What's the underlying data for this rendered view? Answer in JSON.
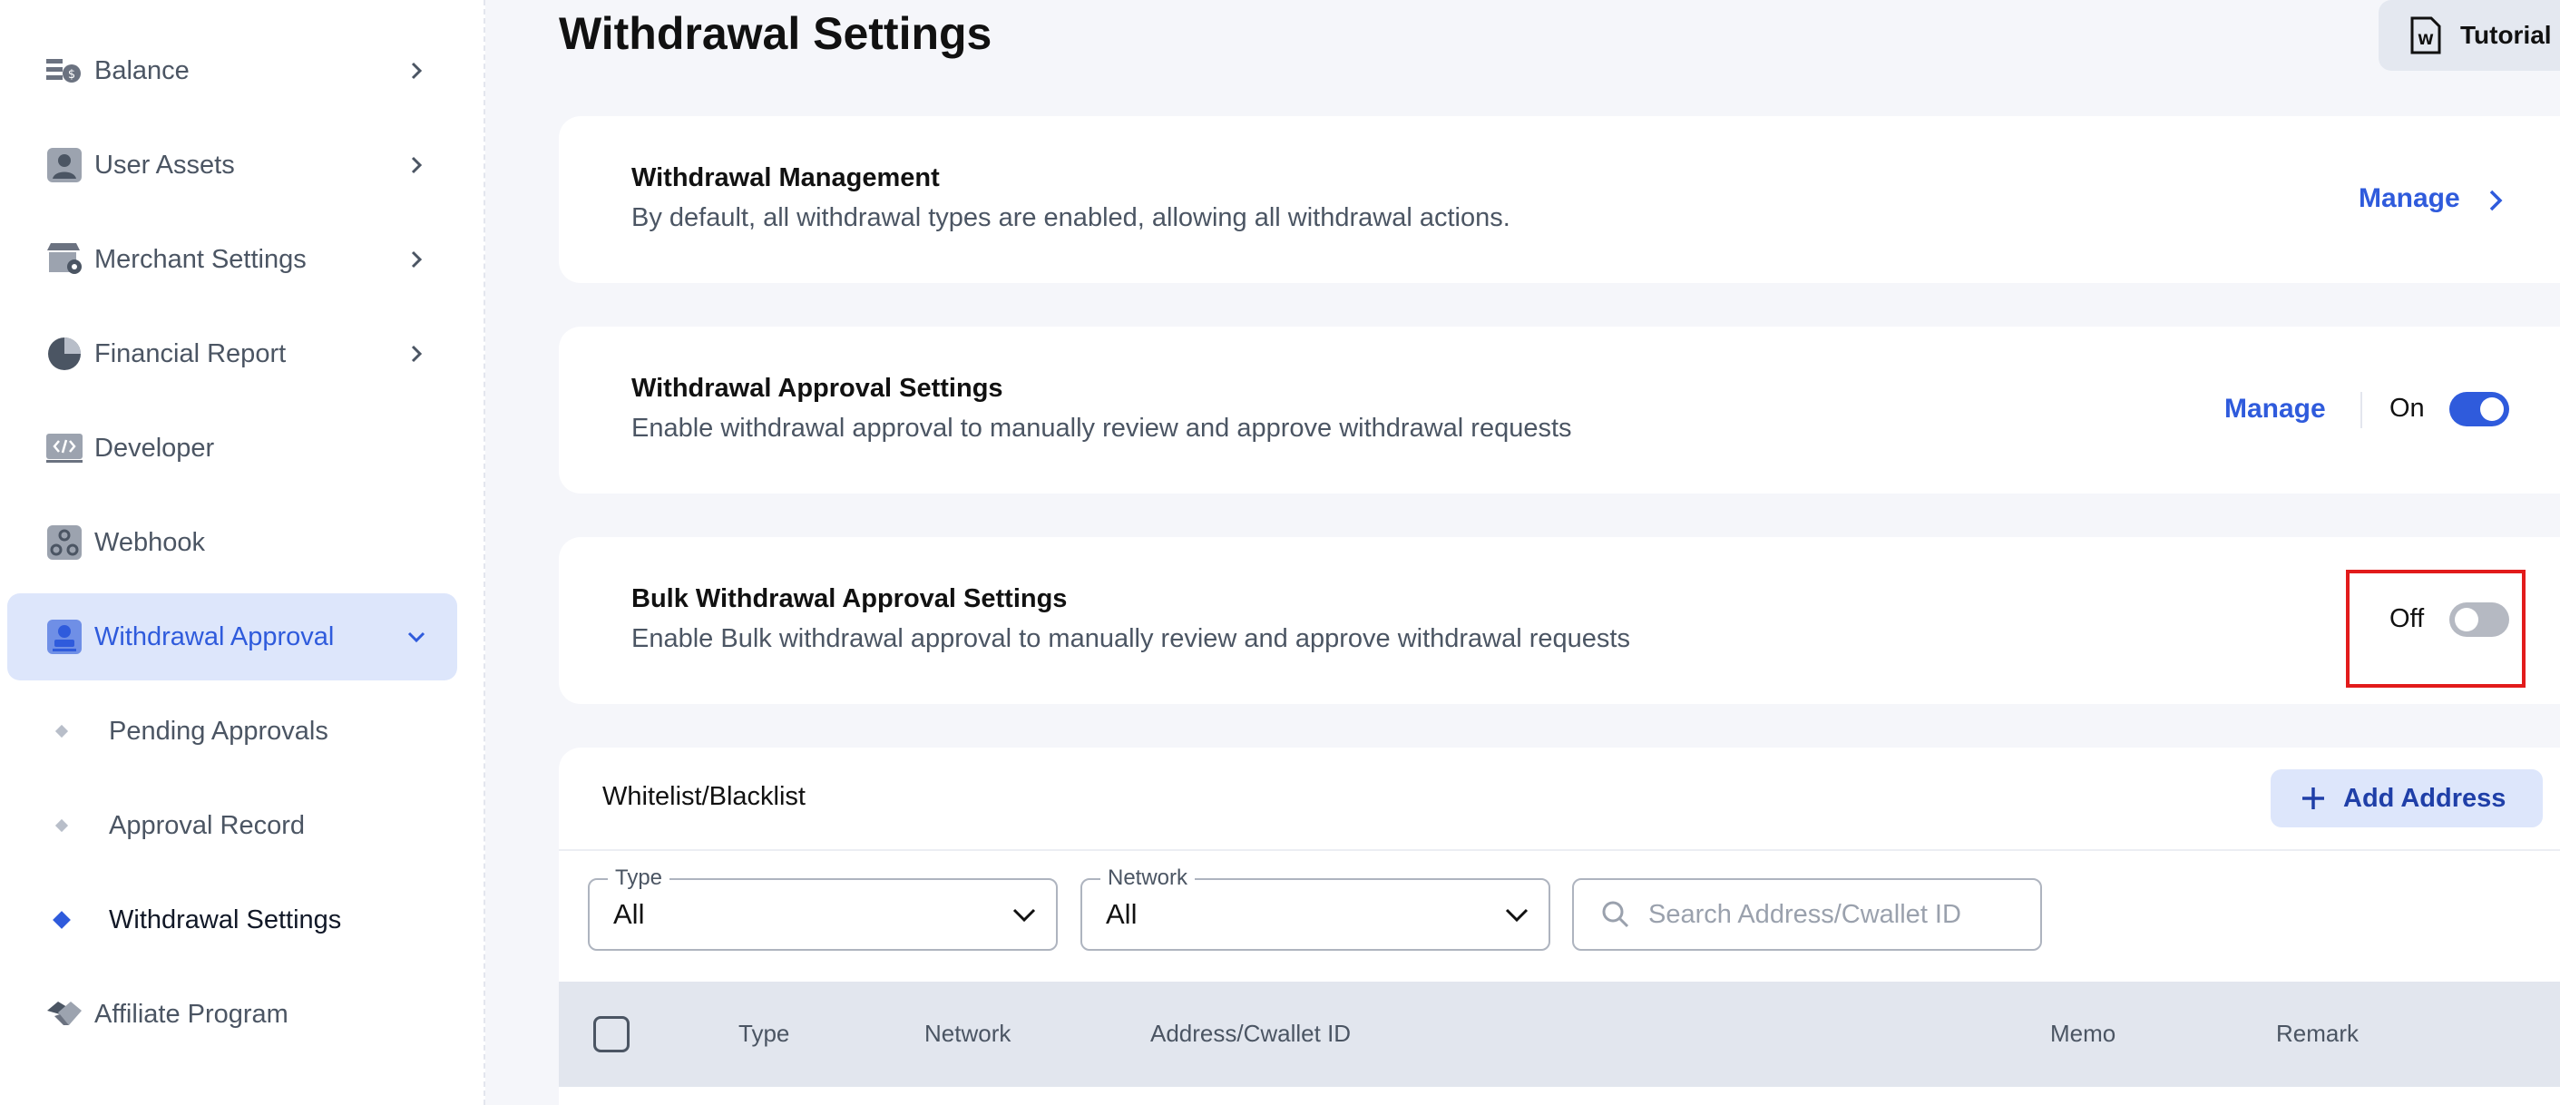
{
  "sidebar": {
    "items": [
      {
        "label": "Balance",
        "icon": "balance-icon"
      },
      {
        "label": "User Assets",
        "icon": "user-assets-icon"
      },
      {
        "label": "Merchant Settings",
        "icon": "merchant-settings-icon"
      },
      {
        "label": "Financial Report",
        "icon": "pie-chart-icon"
      },
      {
        "label": "Developer",
        "icon": "code-icon"
      },
      {
        "label": "Webhook",
        "icon": "webhook-icon"
      },
      {
        "label": "Withdrawal Approval",
        "icon": "approval-stamp-icon"
      },
      {
        "label": "Affiliate Program",
        "icon": "handshake-icon"
      }
    ],
    "sub_items": [
      {
        "label": "Pending Approvals"
      },
      {
        "label": "Approval Record"
      },
      {
        "label": "Withdrawal Settings"
      }
    ]
  },
  "header": {
    "title": "Withdrawal Settings",
    "tutorial_label": "Tutorial"
  },
  "cards": {
    "management": {
      "title": "Withdrawal Management",
      "description": "By default, all withdrawal types are enabled, allowing all withdrawal actions.",
      "link": "Manage"
    },
    "approval": {
      "title": "Withdrawal Approval Settings",
      "description": "Enable withdrawal approval to manually review and approve withdrawal requests",
      "link": "Manage",
      "state": "On"
    },
    "bulk": {
      "title": "Bulk Withdrawal Approval Settings",
      "description": "Enable Bulk withdrawal approval to manually review and approve withdrawal requests",
      "state": "Off"
    }
  },
  "whitelist": {
    "title": "Whitelist/Blacklist",
    "add_label": "Add Address",
    "filters": {
      "type": {
        "legend": "Type",
        "value": "All"
      },
      "network": {
        "legend": "Network",
        "value": "All"
      }
    },
    "search_placeholder": "Search Address/Cwallet ID",
    "columns": [
      "Type",
      "Network",
      "Address/Cwallet ID",
      "Memo",
      "Remark"
    ]
  },
  "colors": {
    "accent": "#2f5bdc",
    "highlight": "#e21b1b",
    "active_bg": "#dde6fb"
  }
}
